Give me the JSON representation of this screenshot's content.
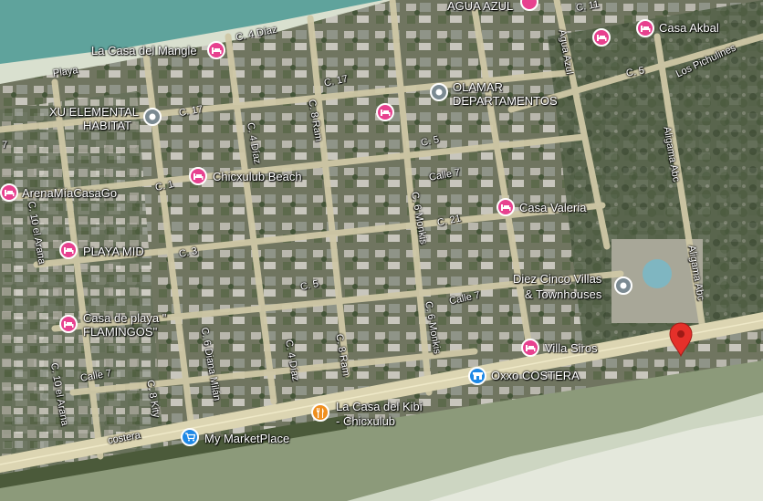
{
  "map": {
    "type": "satellite",
    "colors": {
      "ocean": "#5fa39c",
      "land": "#6d7560",
      "road": "#d6cfa8",
      "sand": "#cdd6c2",
      "hotel_pin": "#e7418f",
      "place_pin": "#7b8a92",
      "shop_pin": "#1e88e5",
      "food_pin": "#ef8f1f",
      "marker": "#e5302a"
    }
  },
  "pois": {
    "agua_azul": "AGUA AZUL",
    "casa_akbal": "Casa Akbal",
    "la_casa_del_mangle": "La Casa del Mangle",
    "olamar_1": "OLAMAR",
    "olamar_2": "DEPARTAMENTOS",
    "xu_elemental_1": "XU ELEMENTAL",
    "xu_elemental_2": "HABITAT",
    "chicxulub_beach": "Chicxulub Beach",
    "arena_mia": "ArenaMíaCasaGo",
    "casa_valeria": "Casa Valeria",
    "playa_mid": "PLAYA MID",
    "diez_cinco_1": "Diez Cinco Villas",
    "diez_cinco_2": "& Townhouses",
    "casa_de_playa_1": "Casa de playa \"",
    "casa_de_playa_2": "FLAMINGOS\"",
    "villa_siros": "Villa Siros",
    "oxxo_costera": "Oxxo COSTERA",
    "la_casa_del_kibi_1": "La Casa del Kibi",
    "la_casa_del_kibi_2": "- Chicxulub",
    "my_marketplace": "My MarketPlace"
  },
  "streets": {
    "c4diaz_top": "C. 4 Díaz",
    "playa": "Playa",
    "c17_a": "C. 17",
    "c17_b": "C. 17",
    "c11_top": "C. 11",
    "aguaazul_st": "Agua Azul",
    "c5_ne": "C. 5",
    "los_pichulines": "Los Pichulines",
    "c4diaz_mid": "C. 4 Díaz",
    "c8ram_top": "C. 8 Ram",
    "c5_mid": "C. 5",
    "aligama_top": "Aligama Abc",
    "calle7_top": "Calle 7",
    "c1": "C. 1",
    "c6monkis_top": "C. 6 Monkis",
    "c21": "C. 21",
    "c10arana_top": "C. 10 el Arana",
    "c3": "C. 3",
    "c5_low": "C. 5",
    "calle7_mid": "Calle 7",
    "aligama_bottom": "Aligama Abc",
    "c6monkis_bottom": "C. 6 Monkis",
    "c6dianamilan": "C. 6 Diana Milán",
    "c4diaz_bottom": "C. 4 Díaz",
    "c8ram_bottom": "C. 8 Ram",
    "calle7_left": "Calle 7",
    "c8kity": "C. 8 Kity",
    "c10arana_bottom": "C. 10 el Arana",
    "costera": "costera",
    "c7_left": "7"
  }
}
